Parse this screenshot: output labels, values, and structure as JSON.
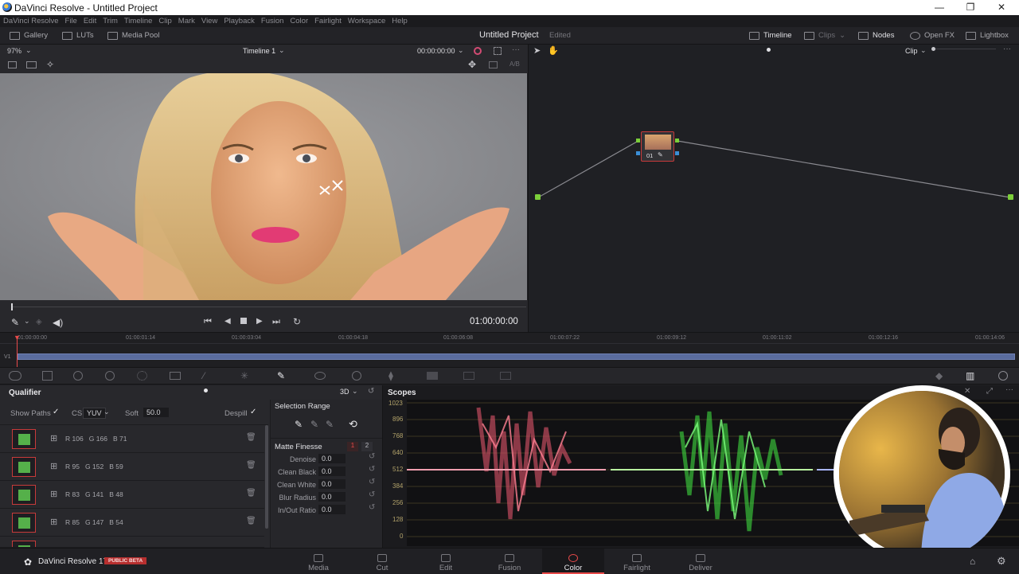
{
  "window": {
    "title": "DaVinci Resolve - Untitled Project",
    "minimize": "—",
    "maximize": "❐",
    "close": "✕"
  },
  "menu": [
    "DaVinci Resolve",
    "File",
    "Edit",
    "Trim",
    "Timeline",
    "Clip",
    "Mark",
    "View",
    "Playback",
    "Fusion",
    "Color",
    "Fairlight",
    "Workspace",
    "Help"
  ],
  "toolbar": {
    "gallery": "Gallery",
    "luts": "LUTs",
    "media_pool": "Media Pool",
    "project_name": "Untitled Project",
    "project_status": "Edited",
    "timeline": "Timeline",
    "clips": "Clips",
    "nodes": "Nodes",
    "open_fx": "Open FX",
    "lightbox": "Lightbox"
  },
  "viewer": {
    "zoom": "97%",
    "timeline_name": "Timeline 1",
    "timecode_top": "00:00:00:00",
    "ab_label": "A/B",
    "timecode": "01:00:00:00"
  },
  "nodes": {
    "clip_selector": "Clip",
    "node_number": "01"
  },
  "mini_timeline": {
    "track": "V1",
    "ticks": [
      "01:00:00:00",
      "01:00:01:14",
      "01:00:03:04",
      "01:00:04:18",
      "01:00:06:08",
      "01:00:07:22",
      "01:00:09:12",
      "01:00:11:02",
      "01:00:12:16",
      "01:00:14:06"
    ]
  },
  "qualifier": {
    "title": "Qualifier",
    "mode": "3D",
    "show_paths": "Show Paths",
    "cs": "CS",
    "cs_value": "YUV",
    "soft": "Soft",
    "soft_value": "50.0",
    "despill": "Despill",
    "samples": [
      {
        "label": "R 106   G 166   B 71"
      },
      {
        "label": "R 95   G 152   B 59"
      },
      {
        "label": "R 83   G 141   B 48"
      },
      {
        "label": "R 85   G 147   B 54"
      }
    ],
    "selection_range": "Selection Range",
    "matte_finesse": "Matte Finesse",
    "mf_tab1": "1",
    "mf_tab2": "2",
    "finesse": [
      {
        "name": "Denoise",
        "value": "0.0"
      },
      {
        "name": "Clean Black",
        "value": "0.0"
      },
      {
        "name": "Clean White",
        "value": "0.0"
      },
      {
        "name": "Blur Radius",
        "value": "0.0"
      },
      {
        "name": "In/Out Ratio",
        "value": "0.0"
      }
    ]
  },
  "scopes": {
    "title": "Scopes",
    "scale": [
      "1023",
      "896",
      "768",
      "640",
      "512",
      "384",
      "256",
      "128",
      "0"
    ]
  },
  "bottom": {
    "app": "DaVinci Resolve 17",
    "beta": "PUBLIC BETA",
    "pages": [
      "Media",
      "Cut",
      "Edit",
      "Fusion",
      "Color",
      "Fairlight",
      "Deliver"
    ],
    "active_page": "Color"
  },
  "colors": {
    "accent_red": "#e84a4a",
    "qualifier_green": "#55b04a",
    "node_green": "#7ccf3a"
  }
}
